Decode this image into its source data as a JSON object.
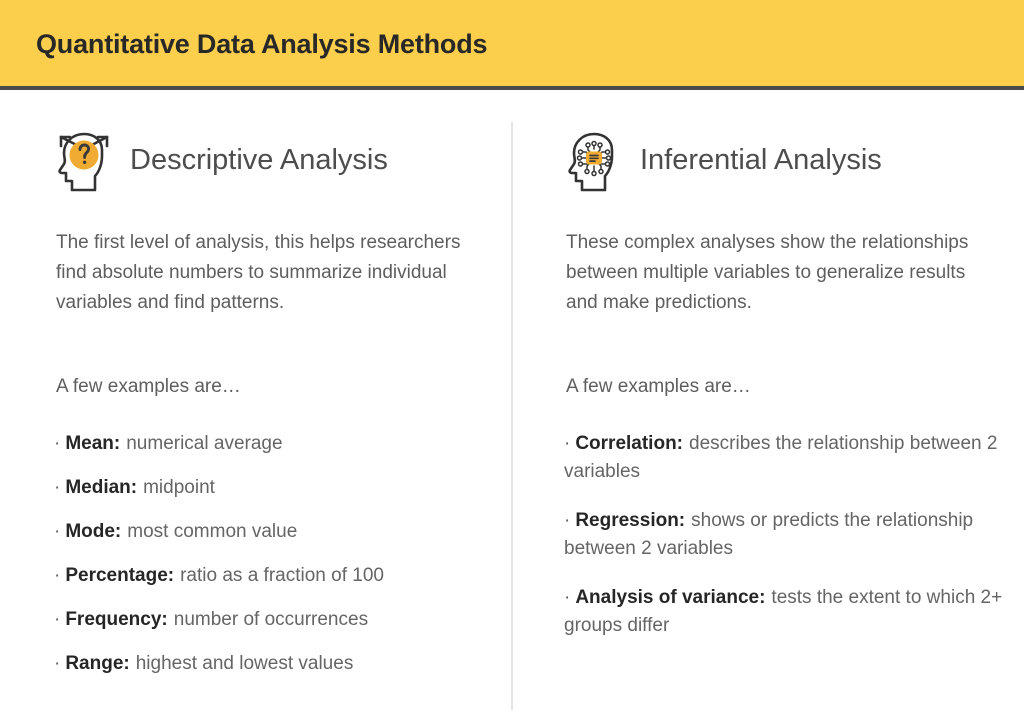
{
  "header": {
    "title": "Quantitative Data Analysis Methods",
    "background_color": "#fbcf4c",
    "rule_color": "#4a4a4a",
    "title_color": "#282828"
  },
  "theme": {
    "accent_yellow": "#f0ab32",
    "icon_stroke": "#333333",
    "body_text": "#5e5e5e",
    "divider": "#e4e4e4",
    "background": "#ffffff"
  },
  "columns": [
    {
      "id": "descriptive",
      "icon_name": "head-question-mark-icon",
      "title": "Descriptive Analysis",
      "description": "The first level of analysis, this helps researchers find absolute numbers to summarize individual variables and find patterns.",
      "examples_lead": "A few examples are…",
      "bullet_marker": "·",
      "items": [
        {
          "term": "Mean:",
          "definition": "numerical average"
        },
        {
          "term": "Median:",
          "definition": "midpoint"
        },
        {
          "term": "Mode:",
          "definition": "most common value"
        },
        {
          "term": "Percentage:",
          "definition": "ratio as a fraction of 100"
        },
        {
          "term": "Frequency:",
          "definition": "number of occurrences"
        },
        {
          "term": "Range:",
          "definition": "highest and lowest values"
        }
      ]
    },
    {
      "id": "inferential",
      "icon_name": "head-circuit-brain-icon",
      "title": "Inferential Analysis",
      "description": "These complex analyses show the relationships between multiple variables to generalize results and make predictions.",
      "examples_lead": "A few examples are…",
      "bullet_marker": "·",
      "items": [
        {
          "term": "Correlation:",
          "definition": "describes the relationship between 2 variables"
        },
        {
          "term": "Regression:",
          "definition": "shows or predicts the relationship between 2 variables"
        },
        {
          "term": "Analysis of variance:",
          "definition": "tests the extent to which 2+ groups differ"
        }
      ]
    }
  ]
}
